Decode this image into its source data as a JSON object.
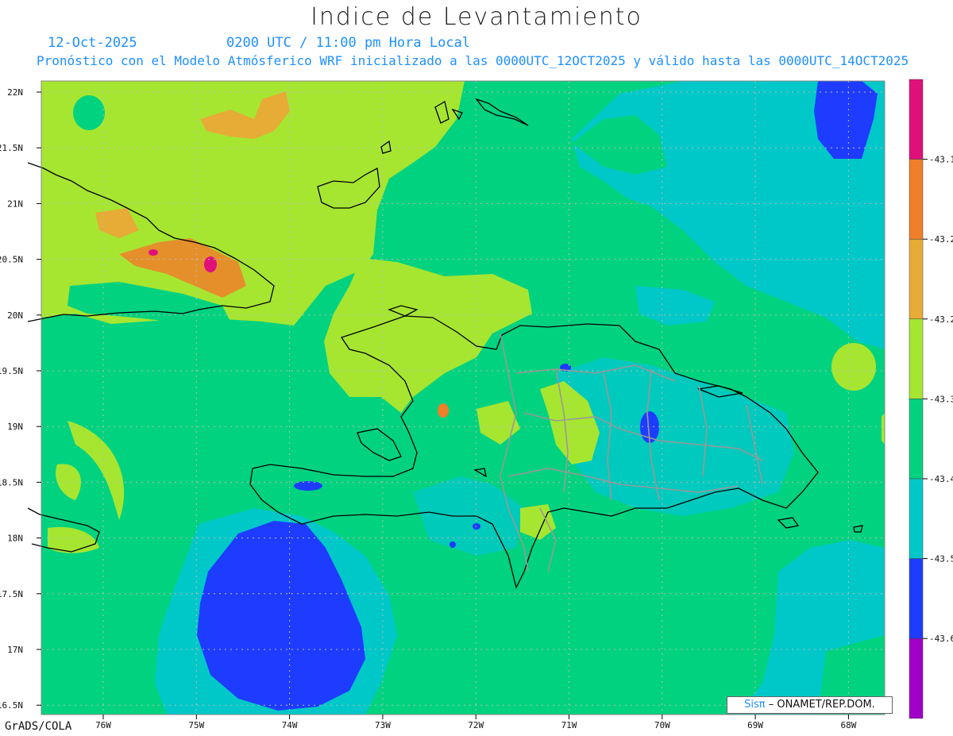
{
  "header": {
    "title": "Indice de Levantamiento",
    "date": "12-Oct-2025",
    "time": "0200 UTC / 11:00 pm Hora Local",
    "description": "Pronóstico con el Modelo Atmósferico WRF inicializado a las 0000UTC_12OCT2025 y válido hasta las  0000UTC_14OCT2025"
  },
  "axes": {
    "lat_labels": [
      "22N",
      "21.5N",
      "21N",
      "20.5N",
      "20N",
      "19.5N",
      "19N",
      "18.5N",
      "18N",
      "17.5N",
      "17N",
      "16.5N"
    ],
    "lon_labels": [
      "76W",
      "75W",
      "74W",
      "73W",
      "72W",
      "71W",
      "70W",
      "69W",
      "68W"
    ]
  },
  "colorbar": {
    "colors": [
      "#e0107a",
      "#f07f2a",
      "#e6ac35",
      "#a6e631",
      "#00d27f",
      "#00c8c8",
      "#1e3cff",
      "#a000c8"
    ],
    "labels": [
      "-43.1",
      "-43.2",
      "-43.2",
      "-43.3",
      "-43.4",
      "-43.5",
      "-43.6"
    ]
  },
  "footer": {
    "software": "GrADS/COLA",
    "credit_logo": "Sisπ",
    "credit_text": "– ONAMET/REP.DOM."
  }
}
